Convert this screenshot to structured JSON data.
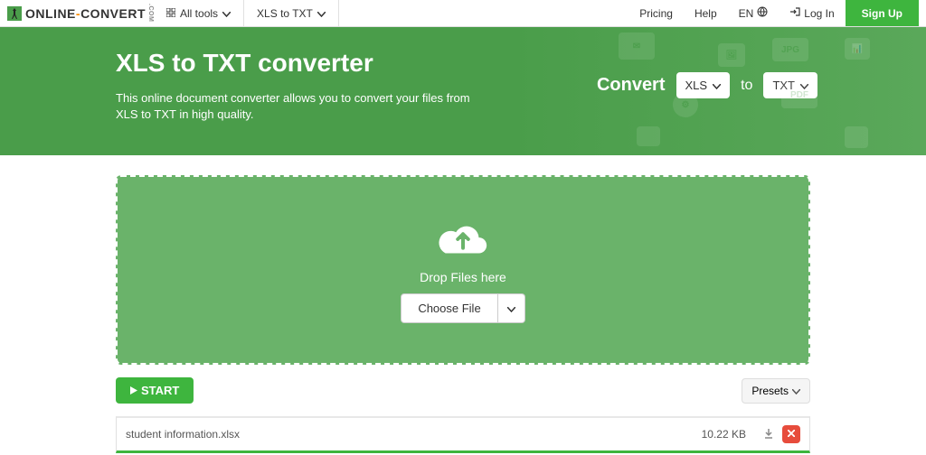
{
  "logo": {
    "text1": "ONLINE",
    "dash": "-",
    "text2": "CONVERT",
    "com": ".COM"
  },
  "nav": {
    "all_tools": "All tools",
    "current_tool": "XLS to TXT"
  },
  "topright": {
    "pricing": "Pricing",
    "help": "Help",
    "lang": "EN",
    "login": "Log In",
    "signup": "Sign Up"
  },
  "hero": {
    "title": "XLS to TXT converter",
    "desc": "This online document converter allows you to convert your files from XLS to TXT in high quality.",
    "convert": "Convert",
    "to": "to",
    "from_fmt": "XLS",
    "to_fmt": "TXT"
  },
  "drop": {
    "text": "Drop Files here",
    "choose": "Choose File"
  },
  "actions": {
    "start": "START",
    "presets": "Presets"
  },
  "file": {
    "name": "student information.xlsx",
    "size": "10.22 KB"
  }
}
